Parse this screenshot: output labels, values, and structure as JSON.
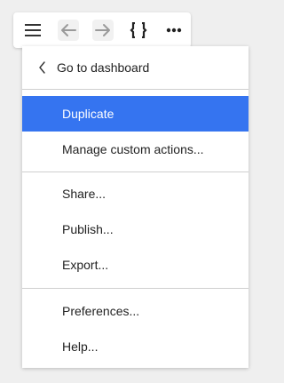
{
  "colors": {
    "active_item_bg": "#3574f0",
    "active_item_text": "#ffffff",
    "text": "#222222",
    "disabled_icon": "#9a9a9a"
  },
  "toolbar": {
    "menu_icon": "hamburger-menu-icon",
    "back_icon": "arrow-left-icon",
    "forward_icon": "arrow-right-icon",
    "braces_icon": "curly-braces-icon",
    "more_icon": "more-horizontal-icon"
  },
  "menu": {
    "header": {
      "icon": "chevron-left-icon",
      "label": "Go to dashboard"
    },
    "groups": [
      {
        "items": [
          {
            "label": "Duplicate",
            "active": true
          },
          {
            "label": "Manage custom actions...",
            "active": false
          }
        ]
      },
      {
        "items": [
          {
            "label": "Share...",
            "active": false
          },
          {
            "label": "Publish...",
            "active": false
          },
          {
            "label": "Export...",
            "active": false
          }
        ]
      },
      {
        "items": [
          {
            "label": "Preferences...",
            "active": false
          },
          {
            "label": "Help...",
            "active": false
          }
        ]
      }
    ]
  }
}
